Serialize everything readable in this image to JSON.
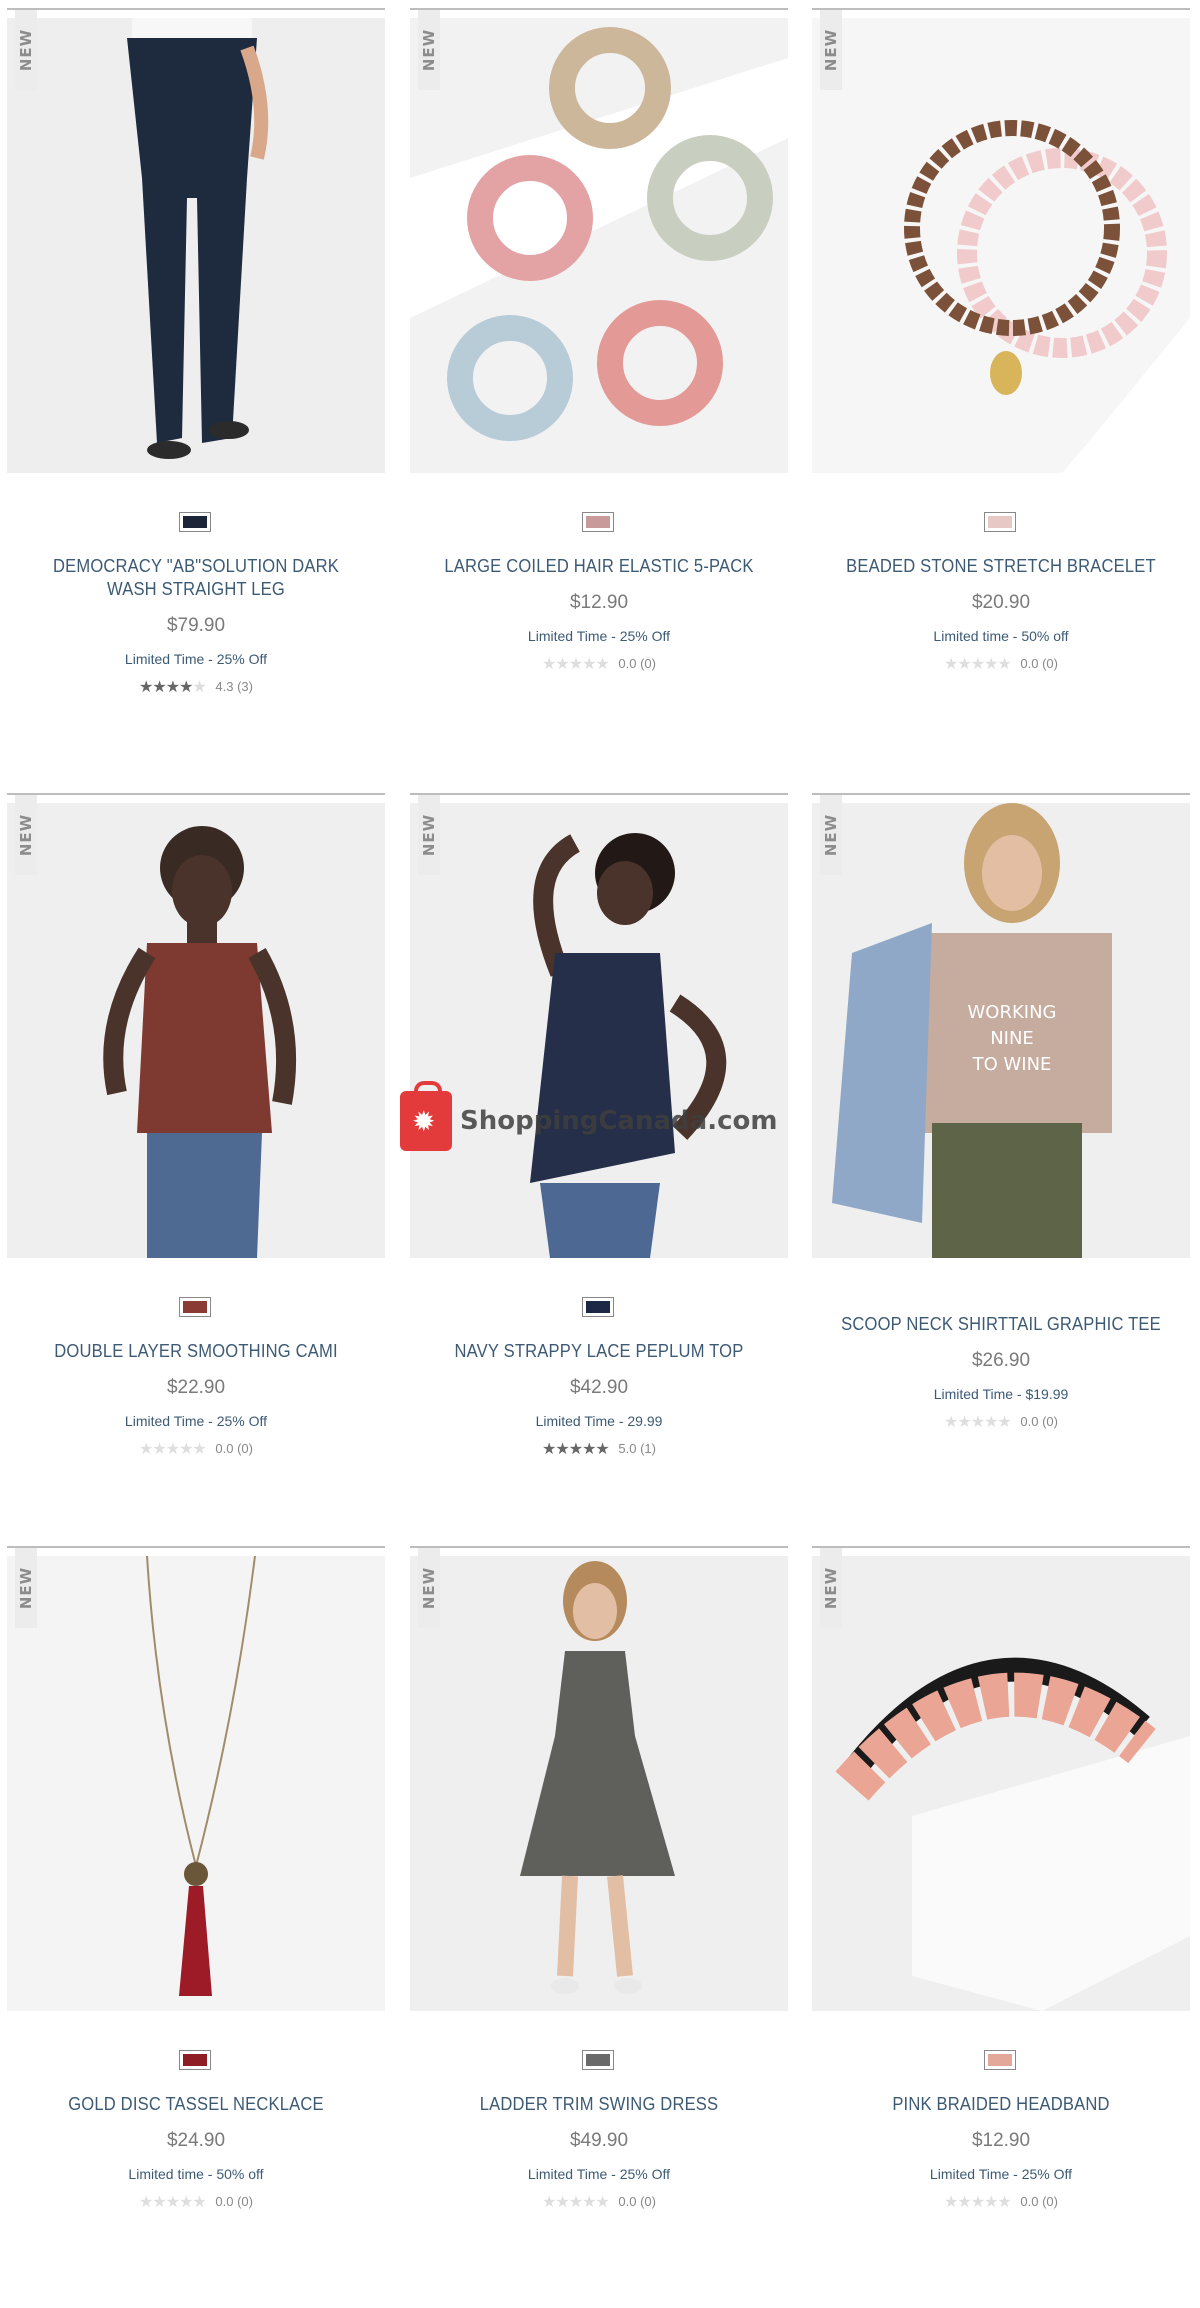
{
  "watermark": {
    "text": "ShoppingCanada.com"
  },
  "products": [
    {
      "badge": "NEW",
      "name": "DEMOCRACY \"AB\"SOLUTION DARK WASH STRAIGHT LEG",
      "price": "$79.90",
      "promo": "Limited Time - 25% Off",
      "rating": 4.3,
      "rating_text": "4.3",
      "reviews": "(3)",
      "swatch_color": "#1c2638",
      "image": "jeans"
    },
    {
      "badge": "NEW",
      "name": "LARGE COILED HAIR ELASTIC 5-PACK",
      "price": "$12.90",
      "promo": "Limited Time - 25% Off",
      "rating": 0,
      "rating_text": "0.0",
      "reviews": "(0)",
      "swatch_color": "#c99a9a",
      "image": "coils"
    },
    {
      "badge": "NEW",
      "name": "BEADED STONE STRETCH BRACELET",
      "price": "$20.90",
      "promo": "Limited time - 50% off",
      "rating": 0,
      "rating_text": "0.0",
      "reviews": "(0)",
      "swatch_color": "#e8c8c4",
      "image": "bracelet"
    },
    {
      "badge": "NEW",
      "name": "DOUBLE LAYER SMOOTHING CAMI",
      "price": "$22.90",
      "promo": "Limited Time - 25% Off",
      "rating": 0,
      "rating_text": "0.0",
      "reviews": "(0)",
      "swatch_color": "#8a3b33",
      "image": "cami"
    },
    {
      "badge": "NEW",
      "name": "NAVY STRAPPY LACE PEPLUM TOP",
      "price": "$42.90",
      "promo": "Limited Time - 29.99",
      "rating": 5,
      "rating_text": "5.0",
      "reviews": "(1)",
      "swatch_color": "#1d2847",
      "image": "peplum"
    },
    {
      "badge": "NEW",
      "name": "SCOOP NECK SHIRTTAIL GRAPHIC TEE",
      "price": "$26.90",
      "promo": "Limited Time - $19.99",
      "rating": 0,
      "rating_text": "0.0",
      "reviews": "(0)",
      "swatch_color": "",
      "image": "tee",
      "tee_text": "WORKING NINE TO WINE"
    },
    {
      "badge": "NEW",
      "name": "GOLD DISC TASSEL NECKLACE",
      "price": "$24.90",
      "promo": "Limited time - 50% off",
      "rating": 0,
      "rating_text": "0.0",
      "reviews": "(0)",
      "swatch_color": "#8f1d25",
      "image": "necklace"
    },
    {
      "badge": "NEW",
      "name": "LADDER TRIM SWING DRESS",
      "price": "$49.90",
      "promo": "Limited Time - 25% Off",
      "rating": 0,
      "rating_text": "0.0",
      "reviews": "(0)",
      "swatch_color": "#6a6a6a",
      "image": "dress"
    },
    {
      "badge": "NEW",
      "name": "PINK BRAIDED HEADBAND",
      "price": "$12.90",
      "promo": "Limited Time - 25% Off",
      "rating": 0,
      "rating_text": "0.0",
      "reviews": "(0)",
      "swatch_color": "#e4a89a",
      "image": "headband"
    }
  ]
}
